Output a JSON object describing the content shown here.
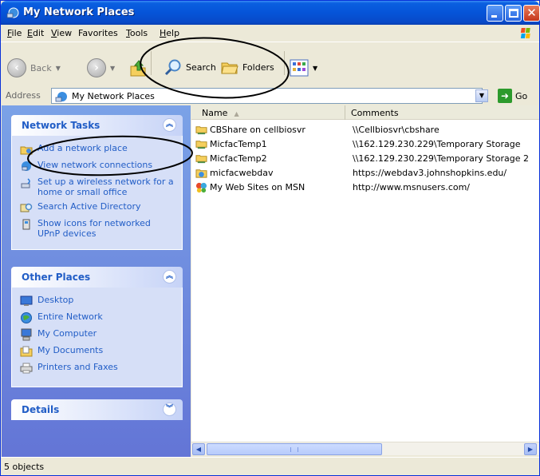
{
  "window": {
    "title": "My Network Places",
    "title_icon": "network-places-icon",
    "buttons": [
      "minimize",
      "maximize",
      "close"
    ]
  },
  "menu": [
    {
      "label": "File",
      "mnemonic_first": "F",
      "rest": "ile"
    },
    {
      "label": "Edit",
      "mnemonic_first": "E",
      "rest": "dit"
    },
    {
      "label": "View",
      "mnemonic_first": "V",
      "rest": "iew"
    },
    {
      "label": "Favorites",
      "mnemonic_first": "",
      "rest": "Favorites"
    },
    {
      "label": "Tools",
      "mnemonic_first": "T",
      "rest": "ools"
    },
    {
      "label": "Help",
      "mnemonic_first": "H",
      "rest": "elp"
    }
  ],
  "toolbar": {
    "back_label": "Back",
    "search_label": "Search",
    "folders_label": "Folders"
  },
  "address": {
    "label": "Address",
    "value": "My Network Places",
    "go_label": "Go"
  },
  "network_tasks": {
    "title": "Network Tasks",
    "items": [
      {
        "label": "Add a network place",
        "icon": "add-network-place-icon"
      },
      {
        "label": "View network connections",
        "icon": "network-connections-icon"
      },
      {
        "label": "Set up a wireless network for a home or small office",
        "icon": "wireless-setup-icon"
      },
      {
        "label": "Search Active Directory",
        "icon": "search-directory-icon"
      },
      {
        "label": "Show icons for networked UPnP devices",
        "icon": "upnp-devices-icon"
      }
    ]
  },
  "other_places": {
    "title": "Other Places",
    "items": [
      {
        "label": "Desktop",
        "icon": "desktop-icon"
      },
      {
        "label": "Entire Network",
        "icon": "globe-icon"
      },
      {
        "label": "My Computer",
        "icon": "computer-icon"
      },
      {
        "label": "My Documents",
        "icon": "documents-folder-icon"
      },
      {
        "label": "Printers and Faxes",
        "icon": "printer-icon"
      }
    ]
  },
  "details": {
    "title": "Details"
  },
  "list": {
    "columns": [
      "Name",
      "Comments"
    ],
    "rows": [
      {
        "name": "CBShare on cellbiosvr",
        "comment": "\\\\Cellbiosvr\\cbshare",
        "icon": "network-share-icon"
      },
      {
        "name": "MicfacTemp1",
        "comment": "\\\\162.129.230.229\\Temporary Storage",
        "icon": "network-share-icon"
      },
      {
        "name": "MicfacTemp2",
        "comment": "\\\\162.129.230.229\\Temporary Storage 2",
        "icon": "network-share-icon"
      },
      {
        "name": "micfacwebdav",
        "comment": "https://webdav3.johnshopkins.edu/",
        "icon": "web-folder-icon"
      },
      {
        "name": "My Web Sites on MSN",
        "comment": "http://www.msnusers.com/",
        "icon": "msn-butterfly-icon"
      }
    ]
  },
  "status": {
    "text": "5 objects"
  },
  "colors": {
    "title_bar": "#0554d8",
    "task_pane": "#6f8fe0",
    "task_link": "#215dc6",
    "annotation_stroke": "#000000"
  }
}
